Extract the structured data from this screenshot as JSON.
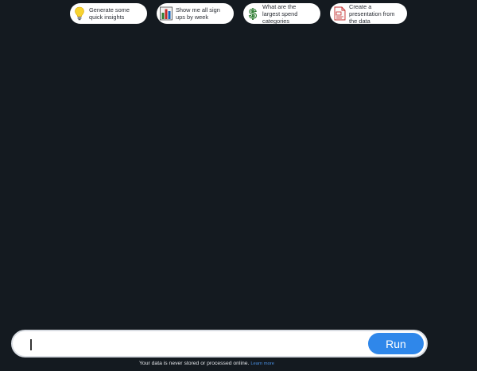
{
  "suggestions": [
    {
      "text": "Generate some quick insights",
      "icon": "lightbulb-icon"
    },
    {
      "text": "Show me all sign ups by week",
      "icon": "bar-chart-icon"
    },
    {
      "text": "What are the largest spend categories",
      "icon": "dollar-sign-icon"
    },
    {
      "text": "Create a presentation from the data",
      "icon": "presentation-document-icon"
    }
  ],
  "input": {
    "value": "",
    "placeholder": ""
  },
  "run_button": {
    "label": "Run"
  },
  "footer": {
    "text": "Your data is never stored or processed online.",
    "link": "Learn more"
  },
  "colors": {
    "background": "#141a20",
    "accent": "#2f87ea",
    "link": "#4a90e2"
  }
}
